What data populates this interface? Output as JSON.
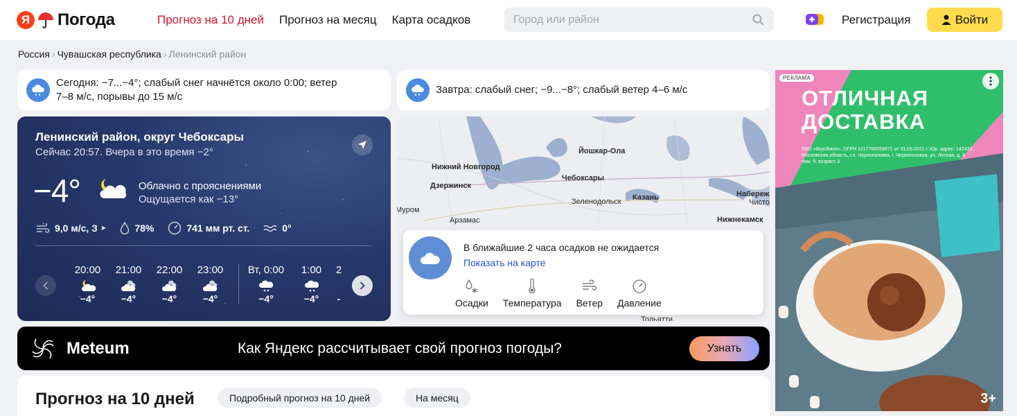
{
  "header": {
    "logo_letter": "Я",
    "logo_text": "Погода",
    "nav": [
      "Прогноз на 10 дней",
      "Прогноз на месяц",
      "Карта осадков"
    ],
    "search_placeholder": "Город или район",
    "register": "Регистрация",
    "login": "Войти"
  },
  "breadcrumb": [
    "Россия",
    "Чувашская республика",
    "Ленинский район"
  ],
  "alerts": {
    "today": "Сегодня: −7...−4°; слабый снег начнётся около 0:00; ветер 7–8 м/с, порывы до 15 м/с",
    "tomorrow": "Завтра: слабый снег; −9...−8°; слабый ветер 4–6 м/с"
  },
  "now": {
    "place": "Ленинский район, округ Чебоксары",
    "time": "Сейчас 20:57. Вчера в это время −2°",
    "temp": "−4°",
    "condition": "Облачно с прояснениями",
    "feels": "Ощущается как −13°",
    "wind": "9,0 м/с, З",
    "humidity": "78%",
    "pressure": "741 мм рт. ст.",
    "water": "0°",
    "hours": [
      {
        "h": "20:00",
        "t": "−4°",
        "icon": "partly-cloudy-night-icon"
      },
      {
        "h": "21:00",
        "t": "−4°",
        "icon": "cloudy-icon"
      },
      {
        "h": "22:00",
        "t": "−4°",
        "icon": "cloudy-icon"
      },
      {
        "h": "23:00",
        "t": "−4°",
        "icon": "cloudy-icon"
      },
      {
        "h": "Вт, 0:00",
        "t": "−4°",
        "icon": "snow-icon"
      },
      {
        "h": "1:00",
        "t": "−4°",
        "icon": "snow-icon"
      },
      {
        "h": "2",
        "t": "-",
        "icon": "snow-icon"
      }
    ]
  },
  "map": {
    "cities": [
      "Йошкар-Ола",
      "Нижний Новгород",
      "Дзержинск",
      "Чебоксары",
      "Зеленодольск",
      "Казань",
      "Набереж",
      "Чисто",
      "Муром",
      "Арзамас",
      "Нижнекамск",
      "Тольятти"
    ],
    "precip_message": "В ближайшие 2 часа осадков не ожидается",
    "show_on_map": "Показать на карте",
    "layers": [
      "Осадки",
      "Температура",
      "Ветер",
      "Давление"
    ]
  },
  "meteum": {
    "name": "Meteum",
    "text": "Как Яндекс рассчитывает свой прогноз погоды?",
    "button": "Узнать"
  },
  "forecast": {
    "title": "Прогноз на 10 дней",
    "chip_detailed": "Подробный прогноз на 10 дней",
    "chip_month": "На месяц"
  },
  "ad": {
    "label": "РЕКЛАМА",
    "headline_1": "ОТЛИЧНАЯ",
    "headline_2": "ДОСТАВКА",
    "legal": "ПАО «ВкусВилл», ОГРН 1217700253671 от 31.05.2021 г. Юр. адрес: 142432, Московская область, г.о. Черноголовка, г. Черноголовка, ул. Лесная, д. 9, пом. 9, возраст 3",
    "age": "3+"
  },
  "colors": {
    "accent_red": "#d9142a",
    "login_yellow": "#ffdb4d",
    "link_blue": "#1f54d1",
    "night_card": "#26386b"
  }
}
